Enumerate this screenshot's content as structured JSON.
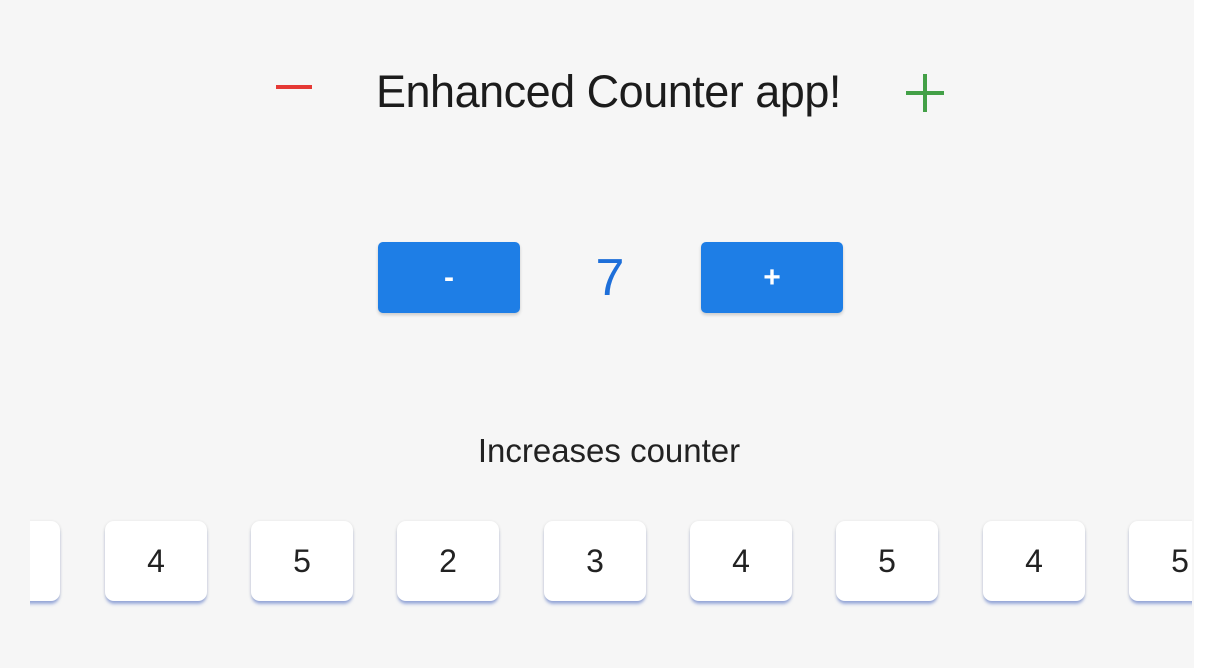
{
  "header": {
    "title": "Enhanced Counter app!",
    "minus_icon": "minus-icon",
    "plus_icon": "plus-icon",
    "minus_color": "#e53935",
    "plus_color": "#43a047"
  },
  "counter": {
    "decrement_label": "-",
    "value": "7",
    "increment_label": "+",
    "button_color": "#1e7ee6",
    "value_color": "#1e6fd9"
  },
  "caption": "Increases counter",
  "history": [
    "",
    "4",
    "5",
    "2",
    "3",
    "4",
    "5",
    "4",
    "5"
  ]
}
